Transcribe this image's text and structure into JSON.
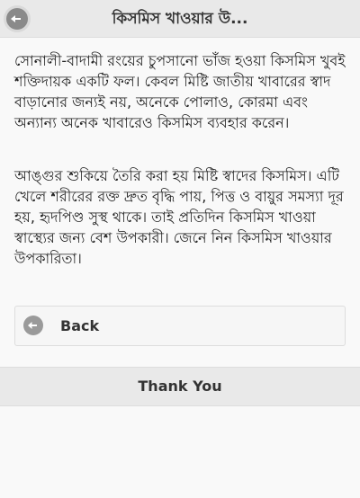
{
  "header": {
    "title": "কিসমিস খাওয়ার উ...",
    "back_icon": "arrow-left-circle-icon"
  },
  "content": {
    "paragraphs": [
      "সোনালী-বাদামী রংয়ের চুপসানো ভাঁজ হওয়া কিসমিস খুবই শক্তিদায়ক একটি ফল। কেবল মিষ্টি জাতীয় খাবারের স্বাদ বাড়ানোর জন্যই নয়, অনেকে পোলাও, কোরমা এবং অন্যান্য অনেক খাবারেও কিসমিস ব্যবহার করেন।",
      "আঙ্গুর শুকিয়ে তৈরি করা হয় মিষ্টি স্বাদের কিসমিস। এটি খেলে শরীরের রক্ত দ্রুত বৃদ্ধি পায়, পিত্ত ও বায়ুর সমস্যা দূর হয়, হৃদপিণ্ড সুস্থ থাকে। তাই প্রতিদিন কিসমিস খাওয়া স্বাস্থ্যের জন্য বেশ উপকারী। জেনে নিন কিসমিস খাওয়ার উপকারিতা।"
    ]
  },
  "back_button": {
    "label": "Back",
    "icon": "arrow-left-circle-icon"
  },
  "footer": {
    "label": "Thank You"
  },
  "colors": {
    "header_bg": "#e9e9e9",
    "page_bg": "#f9f9f9",
    "icon_gray": "#8a8a8a"
  }
}
